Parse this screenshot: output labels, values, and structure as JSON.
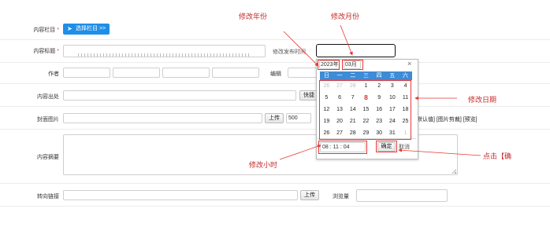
{
  "form": {
    "column_label": "内容栏目",
    "column_button": "选择栏目 >>",
    "title_label": "内容标题",
    "publish_time_label": "修改发布时间",
    "author_label": "作者",
    "editor_label": "编辑",
    "source_label": "内容出处",
    "quick_select_label": "快捷",
    "cover_label": "封面图片",
    "upload_label": "上传",
    "width_value": "500",
    "default_links": "默认值] [图片剪裁] [预览]",
    "summary_label": "内容摘要",
    "redirect_label": "转向链接",
    "upload2_label": "上传",
    "views_label": "浏览量",
    "required_mark": "*"
  },
  "calendar": {
    "year_value": "2023年",
    "month_value": "03月",
    "close_label": "×",
    "weekdays": [
      "日",
      "一",
      "二",
      "三",
      "四",
      "五",
      "六"
    ],
    "weeks": [
      [
        "26",
        "27",
        "28",
        "1",
        "2",
        "3",
        "4"
      ],
      [
        "5",
        "6",
        "7",
        "8",
        "9",
        "10",
        "11"
      ],
      [
        "12",
        "13",
        "14",
        "15",
        "16",
        "17",
        "18"
      ],
      [
        "19",
        "20",
        "21",
        "22",
        "23",
        "24",
        "25"
      ],
      [
        "26",
        "27",
        "28",
        "29",
        "30",
        "31",
        "1"
      ]
    ],
    "time_value": "08 : 11 : 04",
    "confirm_label": "确定",
    "cancel_label": "取消"
  },
  "annotations": {
    "year": "修改年份",
    "month": "修改月份",
    "date": "修改日期",
    "hour": "修改小时",
    "confirm": "点击【确"
  },
  "colors": {
    "accent": "#1e8ee8",
    "calendar_header": "#3e8bd6",
    "annotation": "#c62828"
  }
}
